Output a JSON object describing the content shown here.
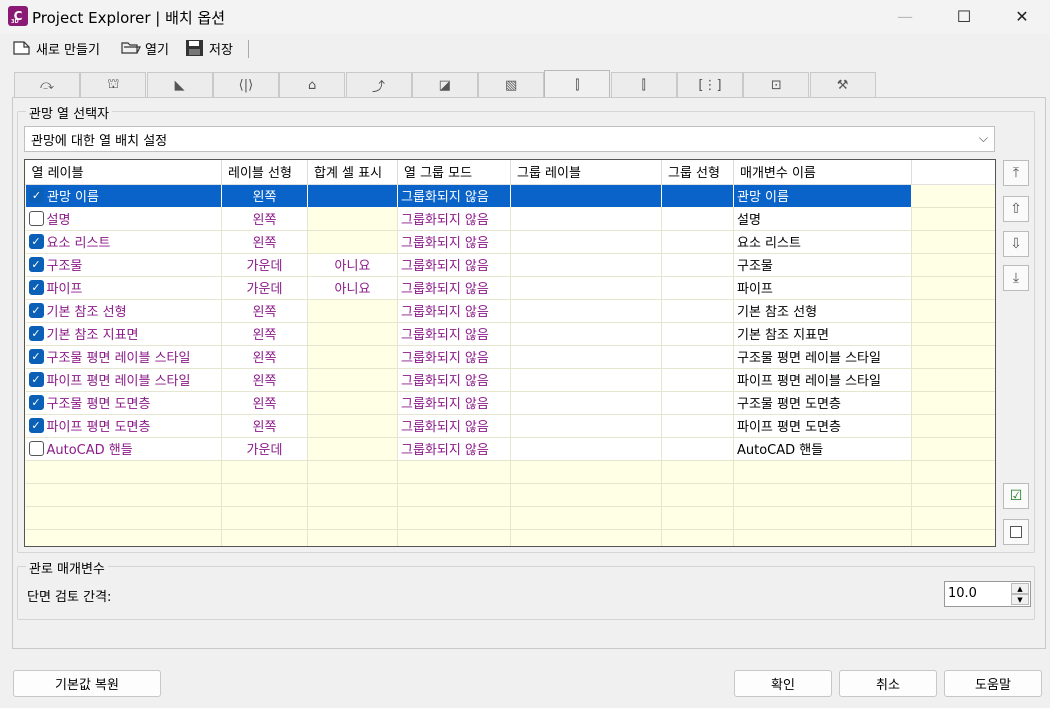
{
  "window": {
    "title": "Project Explorer | 배치 옵션",
    "app_icon_letter": "C",
    "app_icon_sub": "3D",
    "minimize_glyph": "—",
    "maximize_glyph": "☐",
    "close_glyph": "✕"
  },
  "toolbar": {
    "new_label": "새로 만들기",
    "open_label": "열기",
    "save_label": "저장"
  },
  "tabs": [
    {
      "icon": "alignment-icon",
      "glyph": "⤼"
    },
    {
      "icon": "bridge-icon",
      "glyph": "⛫"
    },
    {
      "icon": "road-icon",
      "glyph": "◣"
    },
    {
      "icon": "corridor-icon",
      "glyph": "⟨|⟩"
    },
    {
      "icon": "surface-icon",
      "glyph": "⌂"
    },
    {
      "icon": "profile-icon",
      "glyph": "⤴"
    },
    {
      "icon": "assembly-icon",
      "glyph": "◪"
    },
    {
      "icon": "parcel-icon",
      "glyph": "▧"
    },
    {
      "icon": "pipe-network-icon",
      "glyph": "⫿",
      "active": true
    },
    {
      "icon": "pressure-network-icon",
      "glyph": "⫿"
    },
    {
      "icon": "sample-line-icon",
      "glyph": "[⋮]"
    },
    {
      "icon": "view-icon",
      "glyph": "⊡"
    },
    {
      "icon": "settings-wrench-icon",
      "glyph": "⚒"
    }
  ],
  "network_section": {
    "label": "관망 열 선택자",
    "combo_value": "관망에 대한 열 배치 설정"
  },
  "grid": {
    "headers": [
      "열 레이블",
      "레이블 선형",
      "합계 셀 표시",
      "열 그룹 모드",
      "그룹 레이블",
      "그룹 선형",
      "매개변수 이름",
      ""
    ],
    "rows": [
      {
        "checked": true,
        "label": "관망 이름",
        "justify": "왼쪽",
        "total": "",
        "group_mode": "그룹화되지 않음",
        "group_label": "",
        "group_justify": "",
        "param": "관망 이름"
      },
      {
        "checked": false,
        "label": "설명",
        "justify": "왼쪽",
        "total": "",
        "group_mode": "그룹화되지 않음",
        "group_label": "",
        "group_justify": "",
        "param": "설명"
      },
      {
        "checked": true,
        "label": "요소 리스트",
        "justify": "왼쪽",
        "total": "",
        "group_mode": "그룹화되지 않음",
        "group_label": "",
        "group_justify": "",
        "param": "요소 리스트"
      },
      {
        "checked": true,
        "label": "구조물",
        "justify": "가운데",
        "total": "아니요",
        "group_mode": "그룹화되지 않음",
        "group_label": "",
        "group_justify": "",
        "param": "구조물"
      },
      {
        "checked": true,
        "label": "파이프",
        "justify": "가운데",
        "total": "아니요",
        "group_mode": "그룹화되지 않음",
        "group_label": "",
        "group_justify": "",
        "param": "파이프"
      },
      {
        "checked": true,
        "label": "기본 참조 선형",
        "justify": "왼쪽",
        "total": "",
        "group_mode": "그룹화되지 않음",
        "group_label": "",
        "group_justify": "",
        "param": "기본 참조 선형"
      },
      {
        "checked": true,
        "label": "기본 참조 지표면",
        "justify": "왼쪽",
        "total": "",
        "group_mode": "그룹화되지 않음",
        "group_label": "",
        "group_justify": "",
        "param": "기본 참조 지표면"
      },
      {
        "checked": true,
        "label": "구조물 평면 레이블 스타일",
        "justify": "왼쪽",
        "total": "",
        "group_mode": "그룹화되지 않음",
        "group_label": "",
        "group_justify": "",
        "param": "구조물 평면 레이블 스타일"
      },
      {
        "checked": true,
        "label": "파이프 평면 레이블 스타일",
        "justify": "왼쪽",
        "total": "",
        "group_mode": "그룹화되지 않음",
        "group_label": "",
        "group_justify": "",
        "param": "파이프 평면 레이블 스타일"
      },
      {
        "checked": true,
        "label": "구조물 평면 도면층",
        "justify": "왼쪽",
        "total": "",
        "group_mode": "그룹화되지 않음",
        "group_label": "",
        "group_justify": "",
        "param": "구조물 평면 도면층"
      },
      {
        "checked": true,
        "label": "파이프 평면 도면층",
        "justify": "왼쪽",
        "total": "",
        "group_mode": "그룹화되지 않음",
        "group_label": "",
        "group_justify": "",
        "param": "파이프 평면 도면층"
      },
      {
        "checked": false,
        "label": "AutoCAD 핸들",
        "justify": "가운데",
        "total": "",
        "group_mode": "그룹화되지 않음",
        "group_label": "",
        "group_justify": "",
        "param": "AutoCAD 핸들"
      }
    ],
    "selected_row": 0,
    "empty_rows": 4
  },
  "side_buttons": {
    "move_top_glyph": "⤒",
    "move_up_glyph": "⇧",
    "move_down_glyph": "⇩",
    "move_bottom_glyph": "⤓",
    "check_all_glyph": "☑",
    "uncheck_all_glyph": ""
  },
  "pipe_params": {
    "label": "관로 매개변수",
    "interval_label": "단면 검토 간격:",
    "interval_value": "10.0"
  },
  "buttons": {
    "restore_defaults": "기본값 복원",
    "ok": "확인",
    "cancel": "취소",
    "help": "도움말"
  }
}
